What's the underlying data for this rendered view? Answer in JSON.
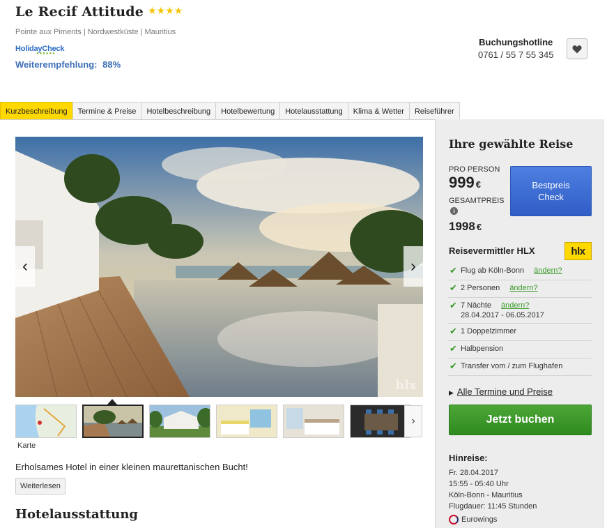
{
  "hotel": {
    "name": "Le Recif Attitude",
    "stars": "★★★★",
    "location": "Pointe aux Piments | Nordwestküste | Mauritius",
    "holidaycheck_logo": "HolidayCheck",
    "recommendation_label": "Weiterempfehlung:",
    "recommendation_value": "88%"
  },
  "hotline": {
    "label": "Buchungshotline",
    "number": "0761 / 55 7 55 345"
  },
  "favorite_icon": "heart-icon",
  "tabs": [
    {
      "label": "Kurzbeschreibung",
      "active": true
    },
    {
      "label": "Termine & Preise",
      "active": false
    },
    {
      "label": "Hotelbeschreibung",
      "active": false
    },
    {
      "label": "Hotelbewertung",
      "active": false
    },
    {
      "label": "Hotelausstattung",
      "active": false
    },
    {
      "label": "Klima & Wetter",
      "active": false
    },
    {
      "label": "Reiseführer",
      "active": false
    }
  ],
  "gallery": {
    "watermark": "hlx",
    "prev_icon": "chevron-left-icon",
    "next_icon": "chevron-right-icon",
    "thumbnails": [
      "Karte",
      "Pool",
      "Anlage",
      "Zimmer",
      "Schlafzimmer",
      "Restaurant"
    ],
    "map_label": "Karte"
  },
  "description": {
    "intro": "Erholsames Hotel in einer kleinen maurettanischen Bucht!",
    "read_more": "Weiterlesen",
    "section_heading": "Hotelausstattung"
  },
  "sidebar": {
    "title": "Ihre gewählte Reise",
    "per_person_label": "PRO PERSON",
    "per_person_price": "999",
    "currency": "€",
    "total_label": "GESAMTPREIS",
    "total_price": "1998",
    "bestprice_button": "Bestpreis Check",
    "agency": "Reisevermittler HLX",
    "agency_logo": "hlx",
    "features": [
      {
        "text": "Flug ab Köln-Bonn",
        "change": "ändern?"
      },
      {
        "text": "2 Personen",
        "change": "ändern?"
      },
      {
        "text": "7 Nächte",
        "change": "ändern?",
        "sub": "28.04.2017 - 06.05.2017"
      },
      {
        "text": "1 Doppelzimmer"
      },
      {
        "text": "Halbpension"
      },
      {
        "text": "Transfer vom / zum Flughafen"
      }
    ],
    "all_dates": "Alle Termine und Preise",
    "book_button": "Jetzt buchen",
    "outbound": {
      "title": "Hinreise:",
      "date": "Fr. 28.04.2017",
      "times": "15:55 - 05:40 Uhr",
      "route": "Köln-Bonn - Mauritius",
      "duration": "Flugdauer: 11:45 Stunden",
      "airline": "Eurowings"
    }
  },
  "colors": {
    "active_tab": "#ffd800",
    "bestprice_button": "#3a6ad4",
    "book_button": "#3a9a2a",
    "link_blue": "#3d6fb6"
  }
}
